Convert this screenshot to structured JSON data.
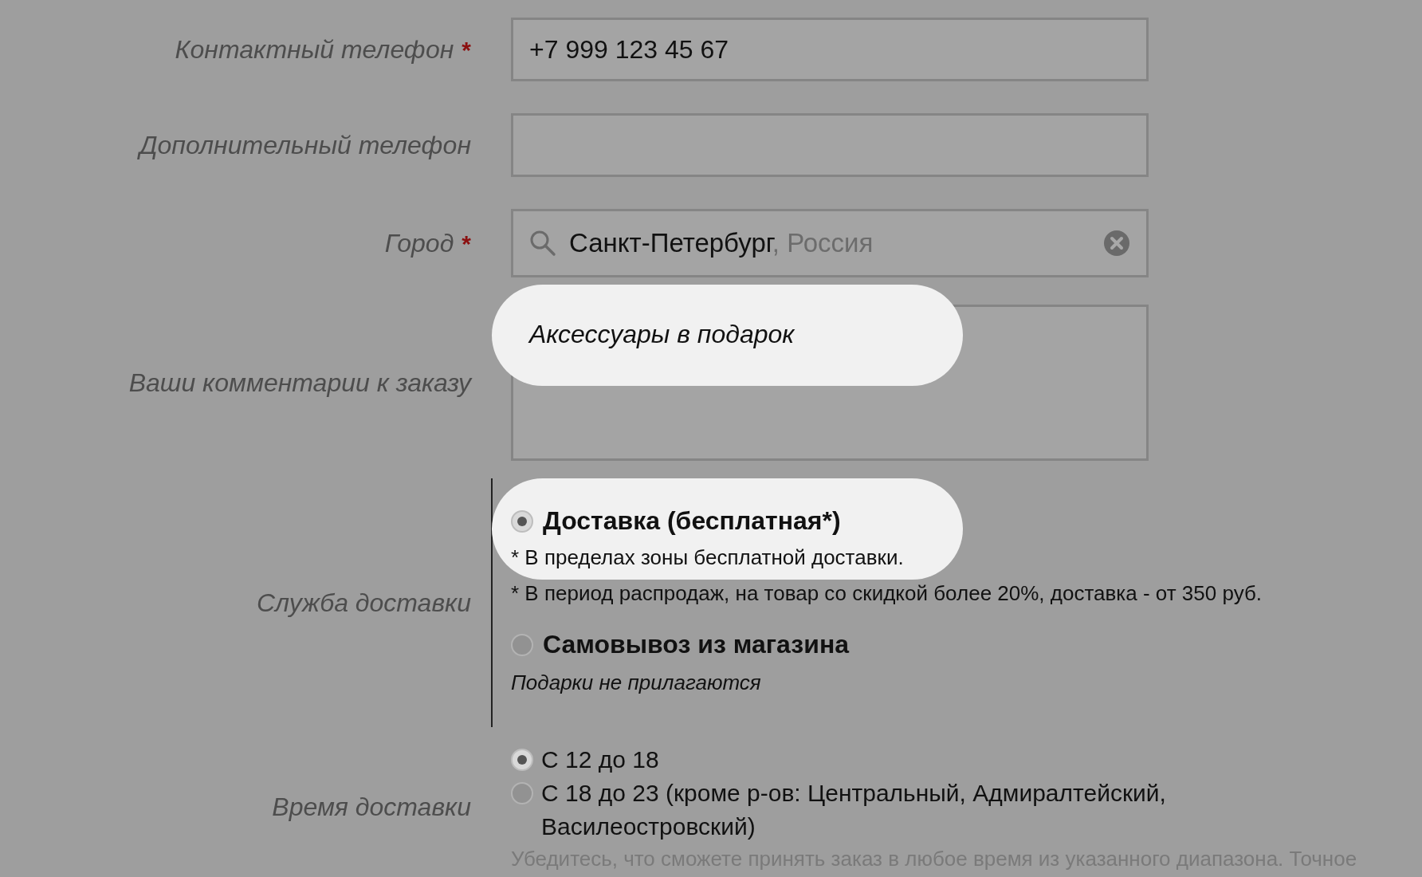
{
  "fields": [
    {
      "kind": "text",
      "label": "Контактный телефон",
      "required_mark": "*",
      "value": "+7 999 123 45 67"
    },
    {
      "kind": "text",
      "label": "Дополнительный телефон"
    },
    {
      "kind": "search",
      "label": "Город",
      "required_mark": "*",
      "value": "Санкт-Петербург",
      "suffix": ", Россия"
    },
    {
      "kind": "textarea",
      "label": "Ваши комментарии к заказу",
      "value": "Аксессуары в подарок",
      "highlighted": true
    }
  ],
  "delivery": {
    "label": "Служба доставки",
    "options": [
      {
        "label": "Доставка (бесплатная*)",
        "selected": true,
        "highlighted": true,
        "notes": [
          {
            "kind": "plain",
            "text": "* В пределах зоны бесплатной доставки."
          },
          {
            "kind": "plain",
            "text": "* В период распродаж, на товар со скидкой более 20%, доставка - от 350 руб."
          }
        ]
      },
      {
        "label": "Самовывоз из магазина",
        "selected": false,
        "notes": [
          {
            "kind": "italic",
            "text": "Подарки не прилагаются"
          }
        ]
      }
    ]
  },
  "delivery_time": {
    "label": "Время доставки",
    "options": [
      {
        "label": "С 12 до 18",
        "selected": true
      },
      {
        "label": "С 18 до 23 (кроме р-ов: Центральный, Адмиралтейский, Василеостровский)",
        "selected": false
      }
    ],
    "note": "Убедитесь, что сможете принять заказ в любое время из указанного диапазона. Точное"
  }
}
